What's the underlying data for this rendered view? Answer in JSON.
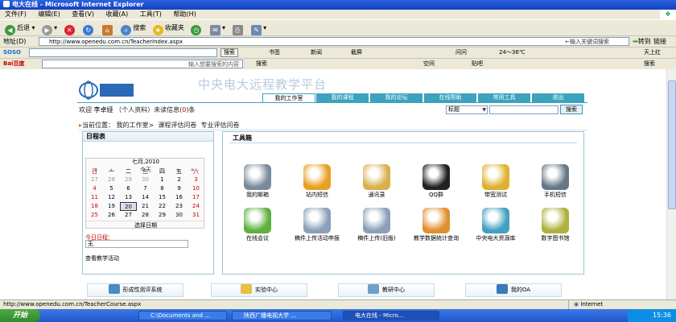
{
  "window": {
    "title": "电大在线 - Microsoft Internet Explorer"
  },
  "menu": {
    "items": [
      "文件(F)",
      "编辑(E)",
      "查看(V)",
      "收藏(A)",
      "工具(T)",
      "帮助(H)"
    ]
  },
  "toolbar": {
    "back": "后退",
    "search": "搜索",
    "favorites": "收藏夹"
  },
  "address": {
    "label": "地址(D)",
    "url": "http://www.openedu.com.cn/TeacherIndex.aspx",
    "hint": "←输入关键词搜索",
    "go": "转到",
    "links": "链接"
  },
  "bar2": {
    "brand": "SOSO",
    "search_btn": "搜索",
    "bookmark": "书签",
    "news": "新闻",
    "screenshot": "截屏",
    "ask": "问问",
    "weather": "24～36℃",
    "sky": "天上红"
  },
  "bar3": {
    "brand": "Bai百度",
    "placeholder": "输入想要搜索的内容",
    "search": "搜索",
    "space": "空间",
    "post": "贴吧",
    "search2": "搜索"
  },
  "site": {
    "title": "中央电大远程教学平台",
    "nav": [
      "我的工作室",
      "我的课程",
      "我的论坛",
      "在线帮助",
      "常用工具",
      "退出"
    ],
    "welcome": {
      "prefix": "欢迎",
      "user": "李卓娅",
      "profile": "（个人资料）",
      "unread_prefix": "未读信息(",
      "unread_count": "0",
      "unread_suffix": ")条"
    },
    "search": {
      "category": "标题",
      "button": "搜索"
    },
    "crumb": {
      "label": "当前位置：",
      "items": [
        "我的工作室>",
        "课程评估问卷",
        "专业评估问卷"
      ]
    }
  },
  "schedule": {
    "title": "日程表",
    "calendar": {
      "month": "七月,2010",
      "today_label": "今天",
      "prev": "«",
      "prev1": "‹",
      "next1": "›",
      "next": "»",
      "weekdays": [
        "日",
        "一",
        "二",
        "三",
        "四",
        "五",
        "六"
      ],
      "rows": [
        [
          "27",
          "28",
          "29",
          "30",
          "1",
          "2",
          "3"
        ],
        [
          "4",
          "5",
          "6",
          "7",
          "8",
          "9",
          "10"
        ],
        [
          "11",
          "12",
          "13",
          "14",
          "15",
          "16",
          "17"
        ],
        [
          "18",
          "19",
          "20",
          "21",
          "22",
          "23",
          "24"
        ],
        [
          "25",
          "26",
          "27",
          "28",
          "29",
          "30",
          "31"
        ]
      ],
      "selected": "20",
      "select_date": "选择日期"
    },
    "today_schedule_label": "今日日程：",
    "today_schedule_value": "无",
    "teaching_activity": "查看教学活动"
  },
  "toolbox": {
    "title": "工具箱",
    "tools": [
      {
        "label": "我的邮箱",
        "color": "#7a8a9a"
      },
      {
        "label": "站内短信",
        "color": "#e8a020"
      },
      {
        "label": "通讯录",
        "color": "#d9b050"
      },
      {
        "label": "QQ群",
        "color": "#222222"
      },
      {
        "label": "带宽测试",
        "color": "#e0b030"
      },
      {
        "label": "手机短信",
        "color": "#667788"
      },
      {
        "label": "在线会议",
        "color": "#60b040"
      },
      {
        "label": "稿件上传活动申报",
        "color": "#8aa0b8"
      },
      {
        "label": "稿件上传(旧版)",
        "color": "#8aa0b8"
      },
      {
        "label": "教学数据统计查询",
        "color": "#e09030"
      },
      {
        "label": "中央电大资源库",
        "color": "#40a0c0"
      },
      {
        "label": "数字图书馆",
        "color": "#b0b040"
      }
    ]
  },
  "bottom": {
    "items": [
      "形成性测评系统",
      "实验中心",
      "教研中心",
      "我的OA"
    ]
  },
  "status": {
    "url": "http://www.openedu.com.cn/TeacherCourse.aspx",
    "zone": "Internet"
  },
  "taskbar": {
    "start": "开始",
    "tasks": [
      "C:\\Documents and ...",
      "陕西广播电视大学 ...",
      "电大在线 - Micro..."
    ],
    "time": "15:36"
  }
}
